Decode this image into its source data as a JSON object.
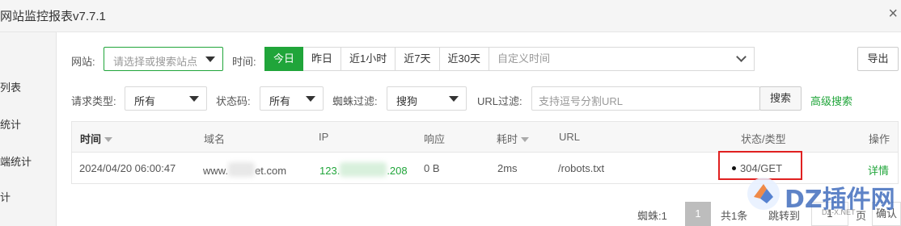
{
  "window": {
    "title": "网站监控报表v7.7.1",
    "close_glyph": "×"
  },
  "sidebar": {
    "items": [
      {
        "label": "列表"
      },
      {
        "label": "统计"
      },
      {
        "label": "端统计"
      },
      {
        "label": "计"
      }
    ]
  },
  "filters": {
    "site_label": "网站:",
    "site_placeholder": "请选择或搜索站点",
    "time_label": "时间:",
    "time_buttons": [
      "今日",
      "昨日",
      "近1小时",
      "近7天",
      "近30天"
    ],
    "active_time": "今日",
    "custom_time_placeholder": "自定义时间",
    "export_label": "导出",
    "request_type_label": "请求类型:",
    "request_type_value": "所有",
    "status_code_label": "状态码:",
    "status_code_value": "所有",
    "spider_label": "蜘蛛过滤:",
    "spider_value": "搜狗",
    "url_filter_label": "URL过滤:",
    "url_filter_placeholder": "支持逗号分割URL",
    "search_label": "搜索",
    "advanced_search_label": "高级搜索"
  },
  "table": {
    "columns": [
      "时间",
      "域名",
      "IP",
      "响应",
      "耗时",
      "URL",
      "状态/类型",
      "操作"
    ],
    "rows": [
      {
        "time": "2024/04/20 06:00:47",
        "domain_prefix": "www.",
        "domain_suffix": "et.com",
        "ip_prefix": "123.",
        "ip_suffix": ".208",
        "response": "0 B",
        "duration": "2ms",
        "url": "/robots.txt",
        "status": "304/GET",
        "action": "详情"
      }
    ]
  },
  "pagination": {
    "spider_count": "蜘蛛:1",
    "current_page": "1",
    "total": "共1条",
    "jump_label": "跳转到",
    "jump_value": "1",
    "page_unit": "页",
    "confirm_label": "确认"
  },
  "watermark": {
    "brand": "DZ插件网",
    "url": "DZ-X.NET"
  },
  "colors": {
    "accent": "#20a53a",
    "highlight_box": "#e02020"
  }
}
